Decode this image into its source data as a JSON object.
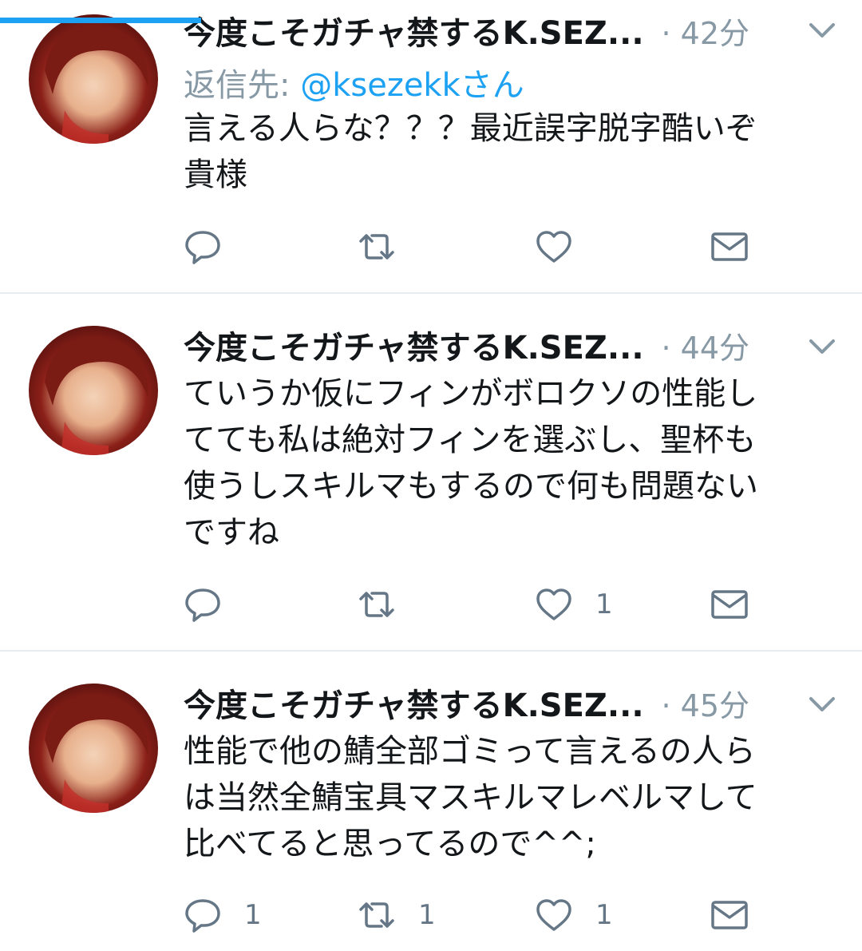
{
  "progress": {
    "fraction": 0.233,
    "color": "#1da1f2"
  },
  "colors": {
    "text": "#14171a",
    "secondary": "#8899a6",
    "link": "#1da1f2",
    "icon": "#657786",
    "divider": "#e6ecf0"
  },
  "tweets": [
    {
      "author": "今度こそガチャ禁するK.SEZ...",
      "time": "· 42分",
      "reply_label": "返信先:",
      "reply_handle": "@ksezekkさん",
      "text": "言える人らな？？？最近誤字脱字酷いぞ\n貴様",
      "counts": {
        "reply": "",
        "retweet": "",
        "like": ""
      }
    },
    {
      "author": "今度こそガチャ禁するK.SEZ...",
      "time": "· 44分",
      "text": "ていうか仮にフィンがボロクソの性能し\nてても私は絶対フィンを選ぶし、聖杯も\n使うしスキルマもするので何も問題ない\nですね",
      "counts": {
        "reply": "",
        "retweet": "",
        "like": "1"
      }
    },
    {
      "author": "今度こそガチャ禁するK.SEZ...",
      "time": "· 45分",
      "text": "性能で他の鯖全部ゴミって言えるの人ら\nは当然全鯖宝具マスキルマレベルマして\n比べてると思ってるので^^;",
      "counts": {
        "reply": "1",
        "retweet": "1",
        "like": "1"
      }
    }
  ],
  "icons": {
    "reply": "reply-bubble-icon",
    "retweet": "retweet-icon",
    "like": "heart-icon",
    "dm": "envelope-icon",
    "caret": "chevron-down-icon"
  }
}
